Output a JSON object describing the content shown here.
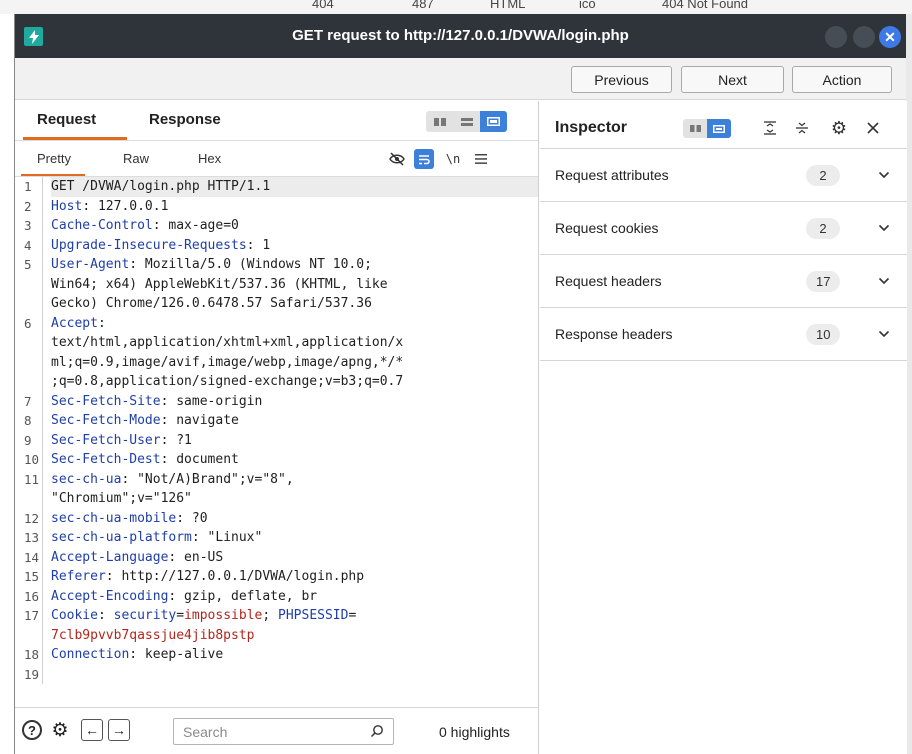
{
  "background": {
    "row_fragments": [
      "404",
      "487",
      "HTML",
      "ico",
      "404 Not Found"
    ]
  },
  "window": {
    "title": "GET request to http://127.0.0.1/DVWA/login.php",
    "close_glyph": "✕"
  },
  "toolbar": {
    "previous_label": "Previous",
    "next_label": "Next",
    "action_label": "Action"
  },
  "editor_panel": {
    "tabs": [
      {
        "label": "Request",
        "active": true
      },
      {
        "label": "Response",
        "active": false
      }
    ],
    "subtabs": [
      {
        "label": "Pretty",
        "active": true
      },
      {
        "label": "Raw",
        "active": false
      },
      {
        "label": "Hex",
        "active": false
      }
    ],
    "newline_toggle_label": "\\n",
    "lines": [
      {
        "num": "1",
        "segments": [
          {
            "t": "GET /DVWA/login.php HTTP/1.1",
            "c": "plain"
          }
        ]
      },
      {
        "num": "2",
        "segments": [
          {
            "t": "Host",
            "c": "hk"
          },
          {
            "t": ": 127.0.0.1",
            "c": "plain"
          }
        ]
      },
      {
        "num": "3",
        "segments": [
          {
            "t": "Cache-Control",
            "c": "hk"
          },
          {
            "t": ": max-age=0",
            "c": "plain"
          }
        ]
      },
      {
        "num": "4",
        "segments": [
          {
            "t": "Upgrade-Insecure-Requests",
            "c": "hk"
          },
          {
            "t": ": 1",
            "c": "plain"
          }
        ]
      },
      {
        "num": "5",
        "segments": [
          {
            "t": "User-Agent",
            "c": "hk"
          },
          {
            "t": ": Mozilla/5.0 (Windows NT 10.0;\nWin64; x64) AppleWebKit/537.36 (KHTML, like\nGecko) Chrome/126.0.6478.57 Safari/537.36",
            "c": "plain"
          }
        ]
      },
      {
        "num": "6",
        "segments": [
          {
            "t": "Accept",
            "c": "hk"
          },
          {
            "t": ":\ntext/html,application/xhtml+xml,application/x\nml;q=0.9,image/avif,image/webp,image/apng,*/*\n;q=0.8,application/signed-exchange;v=b3;q=0.7",
            "c": "plain"
          }
        ]
      },
      {
        "num": "7",
        "segments": [
          {
            "t": "Sec-Fetch-Site",
            "c": "hk"
          },
          {
            "t": ": same-origin",
            "c": "plain"
          }
        ]
      },
      {
        "num": "8",
        "segments": [
          {
            "t": "Sec-Fetch-Mode",
            "c": "hk"
          },
          {
            "t": ": navigate",
            "c": "plain"
          }
        ]
      },
      {
        "num": "9",
        "segments": [
          {
            "t": "Sec-Fetch-User",
            "c": "hk"
          },
          {
            "t": ": ?1",
            "c": "plain"
          }
        ]
      },
      {
        "num": "10",
        "segments": [
          {
            "t": "Sec-Fetch-Dest",
            "c": "hk"
          },
          {
            "t": ": document",
            "c": "plain"
          }
        ]
      },
      {
        "num": "11",
        "segments": [
          {
            "t": "sec-ch-ua",
            "c": "hk"
          },
          {
            "t": ": \"Not/A)Brand\";v=\"8\",\n\"Chromium\";v=\"126\"",
            "c": "plain"
          }
        ]
      },
      {
        "num": "12",
        "segments": [
          {
            "t": "sec-ch-ua-mobile",
            "c": "hk"
          },
          {
            "t": ": ?0",
            "c": "plain"
          }
        ]
      },
      {
        "num": "13",
        "segments": [
          {
            "t": "sec-ch-ua-platform",
            "c": "hk"
          },
          {
            "t": ": \"Linux\"",
            "c": "plain"
          }
        ]
      },
      {
        "num": "14",
        "segments": [
          {
            "t": "Accept-Language",
            "c": "hk"
          },
          {
            "t": ": en-US",
            "c": "plain"
          }
        ]
      },
      {
        "num": "15",
        "segments": [
          {
            "t": "Referer",
            "c": "hk"
          },
          {
            "t": ": http://127.0.0.1/DVWA/login.php",
            "c": "plain"
          }
        ]
      },
      {
        "num": "16",
        "segments": [
          {
            "t": "Accept-Encoding",
            "c": "hk"
          },
          {
            "t": ": gzip, deflate, br",
            "c": "plain"
          }
        ]
      },
      {
        "num": "17",
        "segments": [
          {
            "t": "Cookie",
            "c": "hk"
          },
          {
            "t": ": ",
            "c": "plain"
          },
          {
            "t": "security",
            "c": "ck"
          },
          {
            "t": "=",
            "c": "plain"
          },
          {
            "t": "impossible",
            "c": "cv"
          },
          {
            "t": "; ",
            "c": "plain"
          },
          {
            "t": "PHPSESSID",
            "c": "ck"
          },
          {
            "t": "=\n",
            "c": "plain"
          },
          {
            "t": "7clb9pvvb7qassjue4jib8pstp",
            "c": "cv"
          }
        ]
      },
      {
        "num": "18",
        "segments": [
          {
            "t": "Connection",
            "c": "hk"
          },
          {
            "t": ": keep-alive",
            "c": "plain"
          }
        ]
      },
      {
        "num": "19",
        "segments": [
          {
            "t": "",
            "c": "plain"
          }
        ]
      }
    ],
    "search": {
      "placeholder": "Search",
      "value": ""
    },
    "highlights_label": "0 highlights"
  },
  "inspector": {
    "title": "Inspector",
    "sections": [
      {
        "label": "Request attributes",
        "count": "2"
      },
      {
        "label": "Request cookies",
        "count": "2"
      },
      {
        "label": "Request headers",
        "count": "17"
      },
      {
        "label": "Response headers",
        "count": "10"
      }
    ]
  },
  "colors": {
    "accent_tab": "#e06a20",
    "toggle_active": "#3d80d9",
    "header_key": "#1f3fa8",
    "cookie_value": "#b3261e",
    "titlebar": "#2f343a",
    "app_icon": "#1fa99f"
  }
}
